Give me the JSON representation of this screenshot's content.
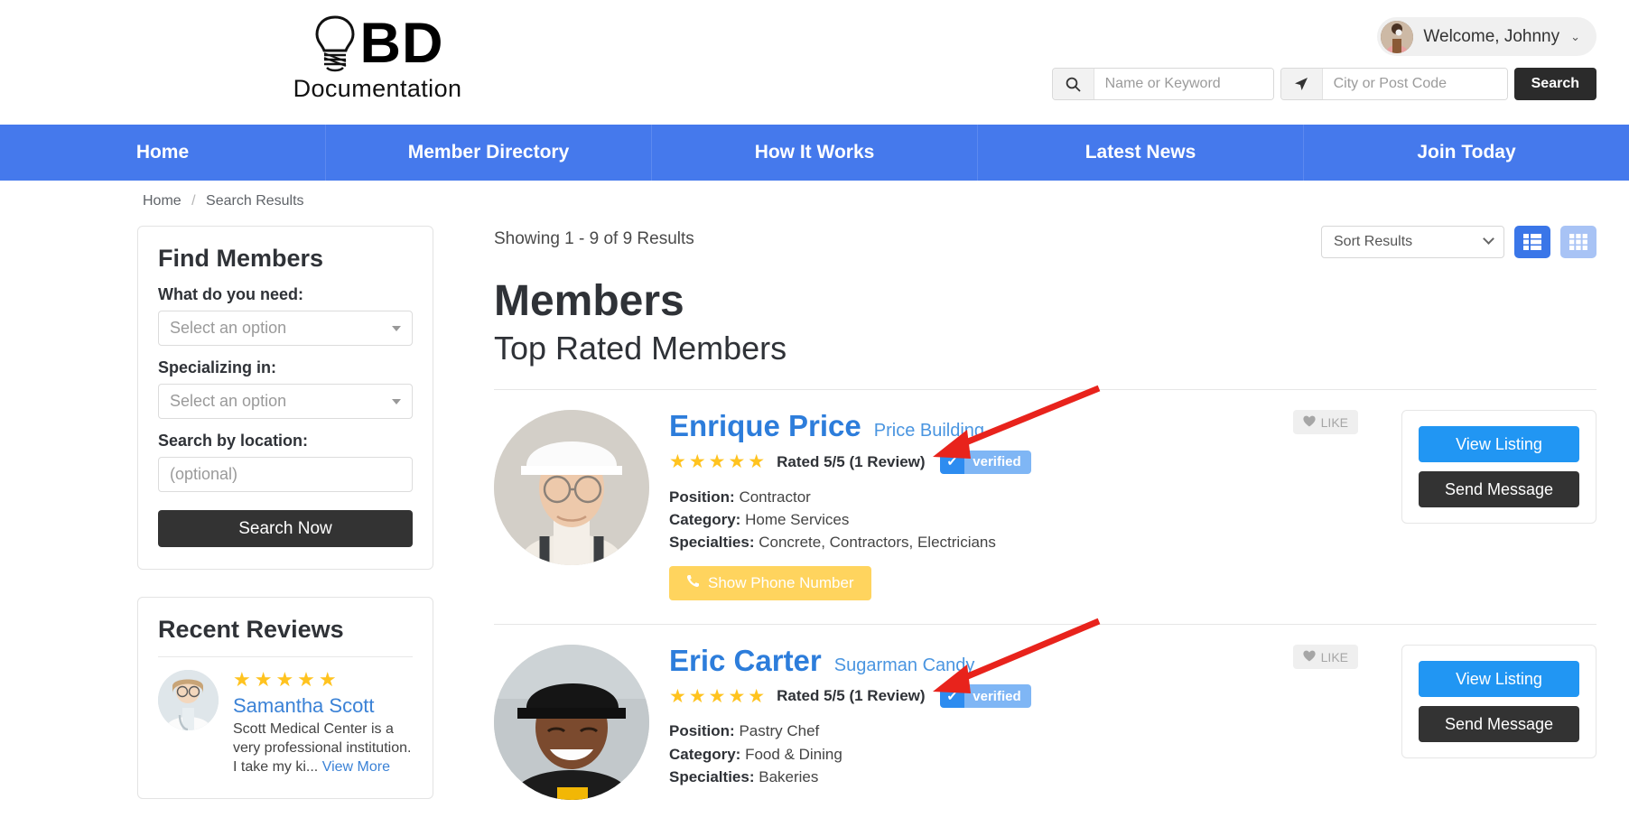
{
  "header": {
    "logo_text": "BD",
    "logo_subtext": "Documentation",
    "logo_icon": "lightbulb-icon",
    "welcome_text": "Welcome, Johnny",
    "welcome_caret": "chevron-down-icon",
    "search": {
      "keyword_placeholder": "Name or Keyword",
      "keyword_value": "",
      "keyword_icon": "search-icon",
      "location_placeholder": "City or Post Code",
      "location_value": "",
      "location_icon": "navigation-arrow-icon",
      "button_label": "Search"
    }
  },
  "nav": {
    "items": [
      {
        "label": "Home"
      },
      {
        "label": "Member Directory"
      },
      {
        "label": "How It Works"
      },
      {
        "label": "Latest News"
      },
      {
        "label": "Join Today"
      }
    ],
    "bg_color": "#4579ec"
  },
  "breadcrumb": {
    "home": "Home",
    "separator": "/",
    "current": "Search Results"
  },
  "sidebar": {
    "find_members": {
      "title": "Find Members",
      "label_need": "What do you need:",
      "select_need_value": "Select an option",
      "label_specializing": "Specializing in:",
      "select_specializing_value": "Select an option",
      "label_location": "Search by location:",
      "location_placeholder": "(optional)",
      "location_value": "",
      "submit_label": "Search Now"
    },
    "recent_reviews": {
      "title": "Recent Reviews",
      "items": [
        {
          "stars": "★★★★★",
          "rating": 5,
          "name": "Samantha Scott",
          "text": "Scott Medical Center is a very professional institution. I take my ki...",
          "view_more": "View More",
          "avatar": "doctor-avatar"
        }
      ]
    }
  },
  "content": {
    "showing": "Showing 1 - 9 of 9 Results",
    "sort_value": "Sort Results",
    "view_list_icon": "list-view-icon",
    "view_grid_icon": "grid-view-icon",
    "view_active": "list",
    "title": "Members",
    "subtitle": "Top Rated Members",
    "labels": {
      "position": "Position:",
      "category": "Category:",
      "specialties": "Specialties:",
      "like": "LIKE",
      "phone": "Show Phone Number",
      "view_listing": "View Listing",
      "send_message": "Send Message",
      "verified": "verified"
    },
    "listings": [
      {
        "name": "Enrique Price",
        "company": "Price Building",
        "stars": "★★★★★",
        "rating_text": "Rated 5/5 (1 Review)",
        "verified": true,
        "position": "Contractor",
        "category": "Home Services",
        "specialties": "Concrete, Contractors, Electricians",
        "avatar": "contractor-avatar",
        "has_phone_button": true
      },
      {
        "name": "Eric Carter",
        "company": "Sugarman Candy",
        "stars": "★★★★★",
        "rating_text": "Rated 5/5 (1 Review)",
        "verified": true,
        "position": "Pastry Chef",
        "category": "Food & Dining",
        "specialties": "Bakeries",
        "avatar": "chef-avatar",
        "has_phone_button": false
      }
    ]
  },
  "annotations": {
    "arrow_color": "#e8231c",
    "arrows": [
      {
        "target": "verified-badge-listing-1"
      },
      {
        "target": "verified-badge-listing-2"
      }
    ]
  }
}
